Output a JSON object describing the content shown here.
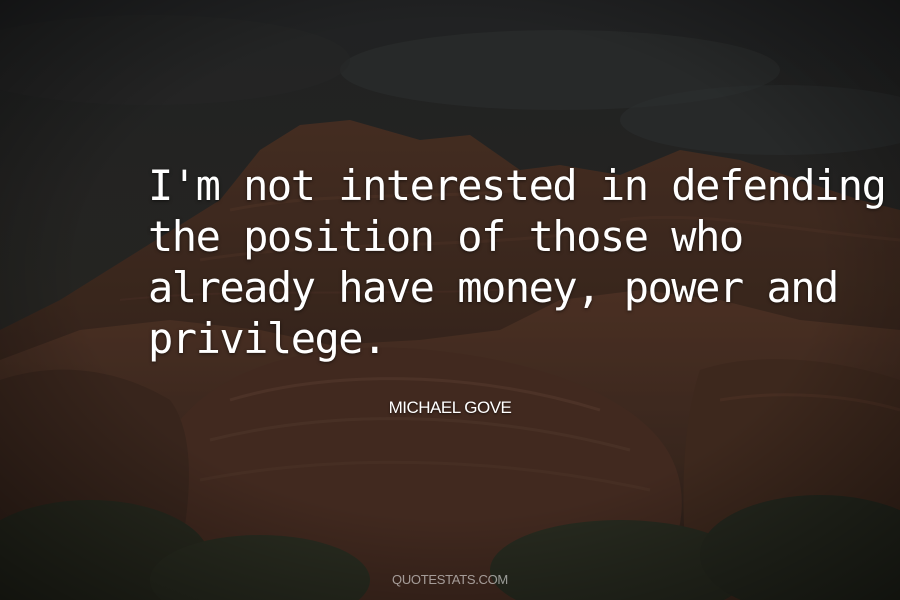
{
  "quote": {
    "lines": [
      "I'm not interested in defending",
      "the position of those who",
      "already have money, power and",
      "privilege."
    ]
  },
  "author": "MICHAEL GOVE",
  "watermark": "QUOTESTATS.COM",
  "colors": {
    "text": "#ffffff",
    "sky": "#2b2d2e",
    "rock": "#5a3a2b",
    "shrub": "#3a3d2c"
  }
}
